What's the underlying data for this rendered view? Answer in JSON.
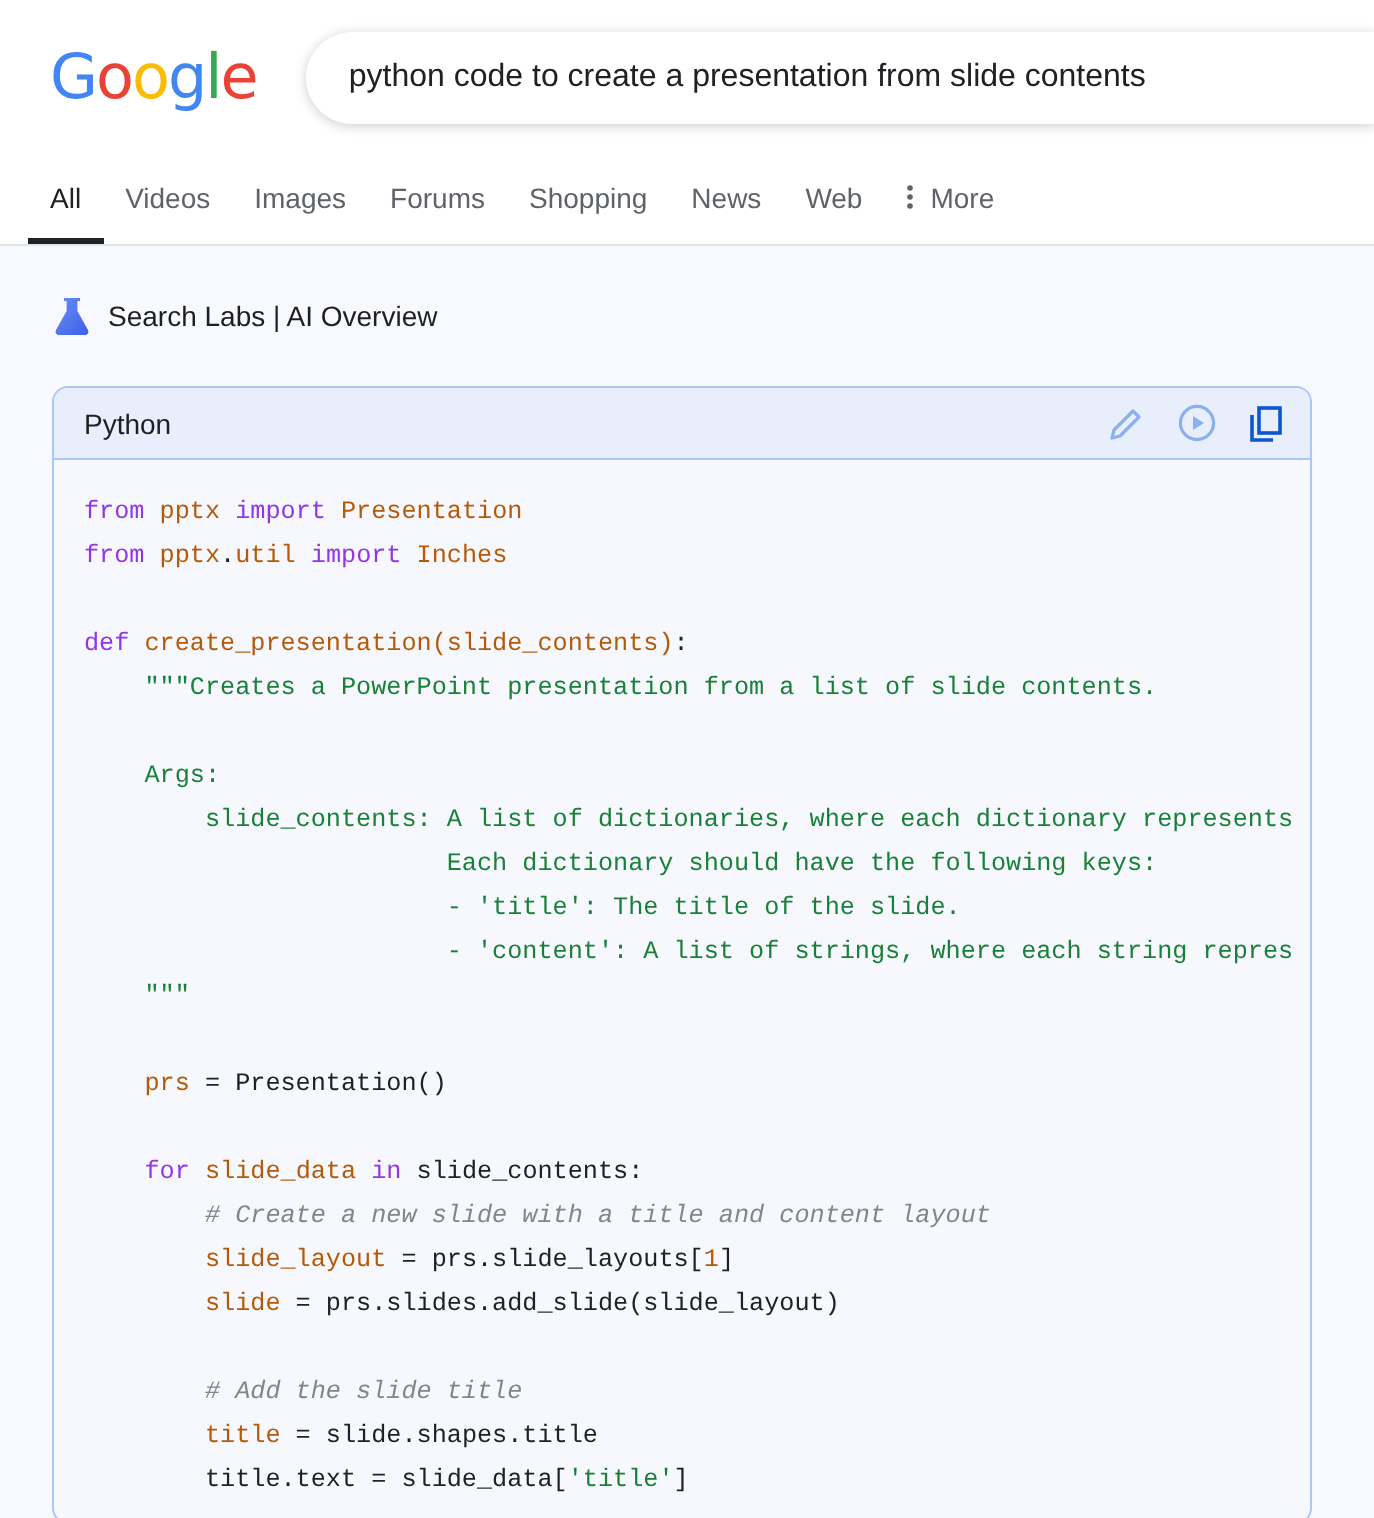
{
  "logo": "Google",
  "search": {
    "value": "python code to create a presentation from slide contents"
  },
  "tabs": [
    {
      "label": "All",
      "selected": true,
      "kind": "link"
    },
    {
      "label": "Videos",
      "selected": false,
      "kind": "link"
    },
    {
      "label": "Images",
      "selected": false,
      "kind": "link"
    },
    {
      "label": "Forums",
      "selected": false,
      "kind": "link"
    },
    {
      "label": "Shopping",
      "selected": false,
      "kind": "link"
    },
    {
      "label": "News",
      "selected": false,
      "kind": "link"
    },
    {
      "label": "Web",
      "selected": false,
      "kind": "link"
    },
    {
      "label": "More",
      "selected": false,
      "kind": "menu"
    }
  ],
  "overview": {
    "title": "Search Labs | AI Overview",
    "code_block": {
      "language": "Python",
      "lines": [
        {
          "kind": "code",
          "tokens": [
            {
              "t": "from ",
              "kind": "keyword"
            },
            {
              "t": "pptx ",
              "kind": "name"
            },
            {
              "t": "import ",
              "kind": "keyword"
            },
            {
              "t": "Presentation",
              "kind": "name"
            }
          ]
        },
        {
          "kind": "code",
          "tokens": [
            {
              "t": "from ",
              "kind": "keyword"
            },
            {
              "t": "pptx",
              "kind": "name"
            },
            {
              "t": ".",
              "kind": "plain"
            },
            {
              "t": "util ",
              "kind": "name"
            },
            {
              "t": "import ",
              "kind": "keyword"
            },
            {
              "t": "Inches",
              "kind": "name"
            }
          ]
        },
        {
          "kind": "blank"
        },
        {
          "kind": "code",
          "tokens": [
            {
              "t": "def ",
              "kind": "keyword"
            },
            {
              "t": "create_presentation(slide_contents)",
              "kind": "name"
            },
            {
              "t": ":",
              "kind": "plain"
            }
          ]
        },
        {
          "kind": "code",
          "tokens": [
            {
              "t": "    \"\"\"Creates a PowerPoint presentation from a list of slide contents.",
              "kind": "string"
            }
          ]
        },
        {
          "kind": "blank"
        },
        {
          "kind": "code",
          "tokens": [
            {
              "t": "    Args:",
              "kind": "string"
            }
          ]
        },
        {
          "kind": "code",
          "tokens": [
            {
              "t": "        slide_contents: A list of dictionaries, where each dictionary represents",
              "kind": "string"
            }
          ]
        },
        {
          "kind": "code",
          "tokens": [
            {
              "t": "                        Each dictionary should have the following keys:",
              "kind": "string"
            }
          ]
        },
        {
          "kind": "code",
          "tokens": [
            {
              "t": "                        - 'title': The title of the slide.",
              "kind": "string"
            }
          ]
        },
        {
          "kind": "code",
          "tokens": [
            {
              "t": "                        - 'content': A list of strings, where each string repres",
              "kind": "string"
            }
          ]
        },
        {
          "kind": "code",
          "tokens": [
            {
              "t": "    \"\"\"",
              "kind": "string"
            }
          ]
        },
        {
          "kind": "blank"
        },
        {
          "kind": "code",
          "tokens": [
            {
              "t": "    prs",
              "kind": "name"
            },
            {
              "t": " = Presentation()",
              "kind": "plain"
            }
          ]
        },
        {
          "kind": "blank"
        },
        {
          "kind": "code",
          "tokens": [
            {
              "t": "    for ",
              "kind": "keyword"
            },
            {
              "t": "slide_data ",
              "kind": "name"
            },
            {
              "t": "in",
              "kind": "keyword"
            },
            {
              "t": " slide_contents:",
              "kind": "plain"
            }
          ]
        },
        {
          "kind": "code",
          "tokens": [
            {
              "t": "        # Create a new slide with a title and content layout",
              "kind": "comment"
            }
          ]
        },
        {
          "kind": "code",
          "tokens": [
            {
              "t": "        slide_layout",
              "kind": "name"
            },
            {
              "t": " = prs.slide_layouts[",
              "kind": "plain"
            },
            {
              "t": "1",
              "kind": "number"
            },
            {
              "t": "]",
              "kind": "plain"
            }
          ]
        },
        {
          "kind": "code",
          "tokens": [
            {
              "t": "        slide",
              "kind": "name"
            },
            {
              "t": " = prs.slides.add_slide(slide_layout)",
              "kind": "plain"
            }
          ]
        },
        {
          "kind": "blank"
        },
        {
          "kind": "code",
          "tokens": [
            {
              "t": "        # Add the slide title",
              "kind": "comment"
            }
          ]
        },
        {
          "kind": "code",
          "tokens": [
            {
              "t": "        title",
              "kind": "name"
            },
            {
              "t": " = slide.shapes.title",
              "kind": "plain"
            }
          ]
        },
        {
          "kind": "code",
          "tokens": [
            {
              "t": "        title.text = slide_data[",
              "kind": "plain"
            },
            {
              "t": "'title'",
              "kind": "string"
            },
            {
              "t": "]",
              "kind": "plain"
            }
          ]
        }
      ]
    }
  }
}
